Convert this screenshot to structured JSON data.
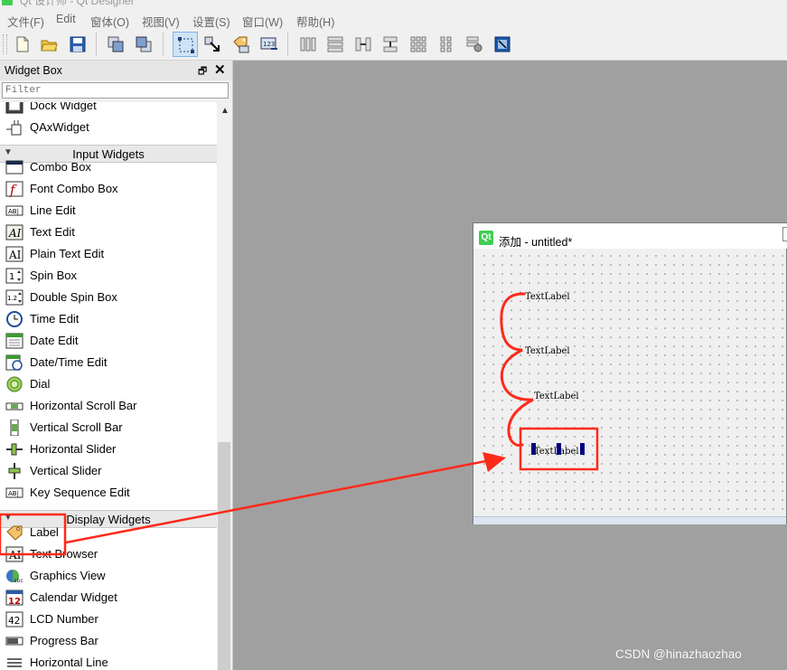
{
  "app": {
    "title": "Qt 设计师 - Qt Designer"
  },
  "menu": [
    "文件(F)",
    "Edit",
    "窗体(O)",
    "视图(V)",
    "设置(S)",
    "窗口(W)",
    "帮助(H)"
  ],
  "widget_box": {
    "title": "Widget Box",
    "float_glyph": "🗗",
    "close_glyph": "✕",
    "filter_placeholder": "Filter",
    "items": [
      {
        "type": "item",
        "label": "Dock Widget",
        "icon": "dock-widget-icon"
      },
      {
        "type": "item",
        "label": "QAxWidget",
        "icon": "qaxwidget-icon"
      },
      {
        "type": "category",
        "label": "Input Widgets"
      },
      {
        "type": "item",
        "label": "Combo Box",
        "icon": "combo-box-icon"
      },
      {
        "type": "item",
        "label": "Font Combo Box",
        "icon": "font-combo-box-icon"
      },
      {
        "type": "item",
        "label": "Line Edit",
        "icon": "line-edit-icon"
      },
      {
        "type": "item",
        "label": "Text Edit",
        "icon": "text-edit-icon"
      },
      {
        "type": "item",
        "label": "Plain Text Edit",
        "icon": "plain-text-edit-icon"
      },
      {
        "type": "item",
        "label": "Spin Box",
        "icon": "spin-box-icon"
      },
      {
        "type": "item",
        "label": "Double Spin Box",
        "icon": "double-spin-box-icon"
      },
      {
        "type": "item",
        "label": "Time Edit",
        "icon": "time-edit-icon"
      },
      {
        "type": "item",
        "label": "Date Edit",
        "icon": "date-edit-icon"
      },
      {
        "type": "item",
        "label": "Date/Time Edit",
        "icon": "date-time-edit-icon"
      },
      {
        "type": "item",
        "label": "Dial",
        "icon": "dial-icon"
      },
      {
        "type": "item",
        "label": "Horizontal Scroll Bar",
        "icon": "horizontal-scroll-bar-icon"
      },
      {
        "type": "item",
        "label": "Vertical Scroll Bar",
        "icon": "vertical-scroll-bar-icon"
      },
      {
        "type": "item",
        "label": "Horizontal Slider",
        "icon": "horizontal-slider-icon"
      },
      {
        "type": "item",
        "label": "Vertical Slider",
        "icon": "vertical-slider-icon"
      },
      {
        "type": "item",
        "label": "Key Sequence Edit",
        "icon": "key-sequence-edit-icon"
      },
      {
        "type": "category",
        "label": "Display Widgets"
      },
      {
        "type": "item",
        "label": "Label",
        "icon": "label-icon"
      },
      {
        "type": "item",
        "label": "Text Browser",
        "icon": "text-browser-icon"
      },
      {
        "type": "item",
        "label": "Graphics View",
        "icon": "graphics-view-icon"
      },
      {
        "type": "item",
        "label": "Calendar Widget",
        "icon": "calendar-widget-icon"
      },
      {
        "type": "item",
        "label": "LCD Number",
        "icon": "lcd-number-icon"
      },
      {
        "type": "item",
        "label": "Progress Bar",
        "icon": "progress-bar-icon"
      },
      {
        "type": "item",
        "label": "Horizontal Line",
        "icon": "horizontal-line-icon"
      }
    ]
  },
  "form": {
    "logo": "Qt",
    "title": "添加 - untitled*",
    "labels": [
      "TextLabel",
      "TextLabel",
      "TextLabel",
      "TextLabel"
    ]
  },
  "watermark": "CSDN @hinazhaozhao",
  "colors": {
    "annotation_red": "#ff2a1a",
    "selection_handle": "#000080",
    "qt_green": "#41cd52",
    "canvas_gray": "#a0a0a0"
  }
}
